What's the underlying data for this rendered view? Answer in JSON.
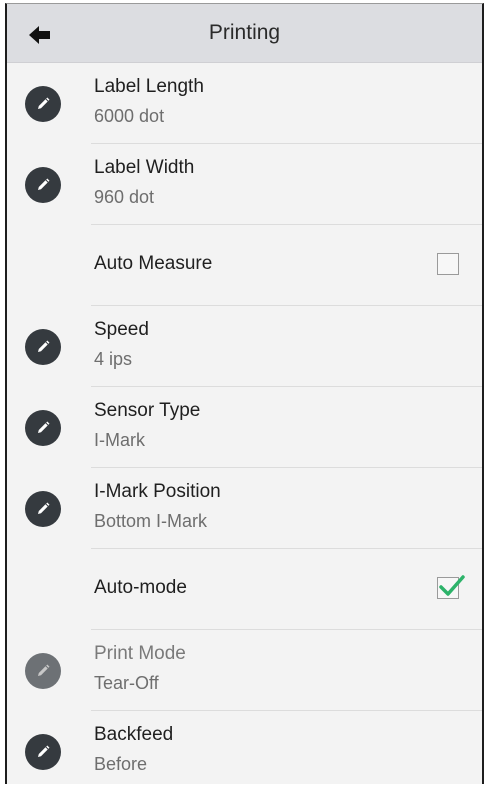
{
  "header": {
    "title": "Printing",
    "back_icon": "arrow-left-icon"
  },
  "rows": [
    {
      "title": "Label Length",
      "value": "6000 dot"
    },
    {
      "title": "Label Width",
      "value": "960 dot"
    },
    {
      "label": "Auto Measure",
      "checked": false
    },
    {
      "title": "Speed",
      "value": "4 ips"
    },
    {
      "title": "Sensor Type",
      "value": "I-Mark"
    },
    {
      "title": "I-Mark Position",
      "value": "Bottom I-Mark"
    },
    {
      "label": "Auto-mode",
      "checked": true
    },
    {
      "title": "Print Mode",
      "value": "Tear-Off",
      "disabled": true
    },
    {
      "title": "Backfeed",
      "value": "Before"
    }
  ],
  "colors": {
    "accent_check": "#2db36a",
    "icon_bg": "#353a3f"
  }
}
